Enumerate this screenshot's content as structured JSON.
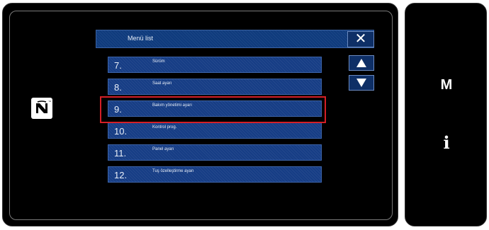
{
  "menu": {
    "title": "Menü list",
    "close_label": "✕",
    "items": [
      {
        "number": "7.",
        "label": "Sürüm"
      },
      {
        "number": "8.",
        "label": "Saat ayarı"
      },
      {
        "number": "9.",
        "label": "Bakım yönetimi ayarı",
        "selected": true
      },
      {
        "number": "10.",
        "label": "Kontrol prog."
      },
      {
        "number": "11.",
        "label": "Panel ayarı"
      },
      {
        "number": "12.",
        "label": "Tuş özelleştirme ayarı"
      }
    ]
  },
  "scroll": {
    "up_icon": "triangle-up",
    "down_icon": "triangle-down"
  },
  "side_panel": {
    "m_label": "M",
    "info_label": "i"
  },
  "nfc_icon": "nfc-logo",
  "colors": {
    "accent": "#163d85",
    "selection": "#d41f26",
    "background": "#000000"
  }
}
